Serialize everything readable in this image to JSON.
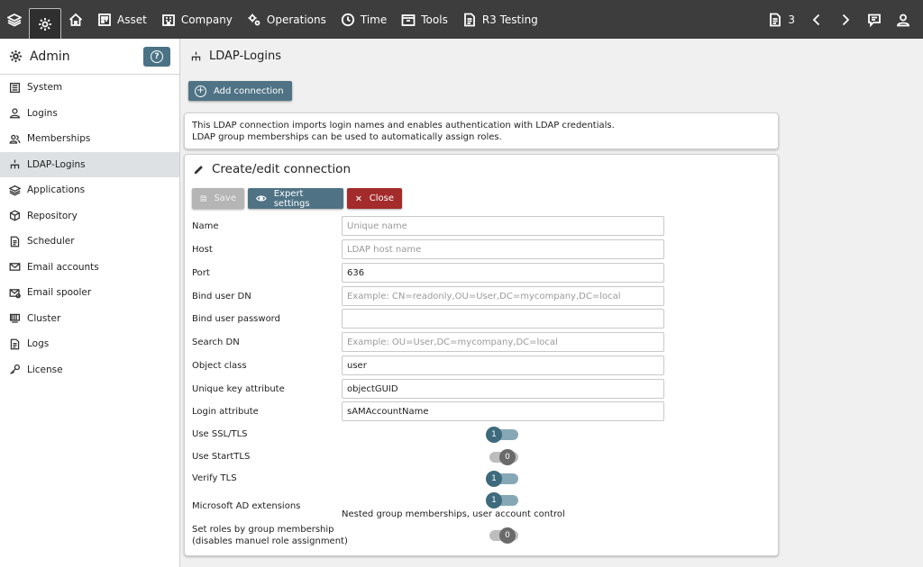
{
  "topbar": {
    "items": [
      {
        "icon": "layers-icon",
        "label": ""
      },
      {
        "icon": "gear-icon",
        "label": ""
      },
      {
        "icon": "home-icon",
        "label": ""
      },
      {
        "icon": "asset-icon",
        "label": "Asset"
      },
      {
        "icon": "company-icon",
        "label": "Company"
      },
      {
        "icon": "operations-icon",
        "label": "Operations"
      },
      {
        "icon": "clock-icon",
        "label": "Time"
      },
      {
        "icon": "tools-icon",
        "label": "Tools"
      },
      {
        "icon": "document-icon",
        "label": "R3 Testing"
      }
    ],
    "right": {
      "doc_count": "3"
    }
  },
  "sidebar": {
    "title": "Admin",
    "help_label": "?",
    "items": [
      {
        "icon": "system-icon",
        "label": "System"
      },
      {
        "icon": "user-icon",
        "label": "Logins"
      },
      {
        "icon": "users-icon",
        "label": "Memberships"
      },
      {
        "icon": "hierarchy-icon",
        "label": "LDAP-Logins"
      },
      {
        "icon": "layers-icon",
        "label": "Applications"
      },
      {
        "icon": "cube-icon",
        "label": "Repository"
      },
      {
        "icon": "scheduler-icon",
        "label": "Scheduler"
      },
      {
        "icon": "mail-icon",
        "label": "Email accounts"
      },
      {
        "icon": "mail-spooler-icon",
        "label": "Email spooler"
      },
      {
        "icon": "cluster-icon",
        "label": "Cluster"
      },
      {
        "icon": "logs-icon",
        "label": "Logs"
      },
      {
        "icon": "key-icon",
        "label": "License"
      }
    ],
    "active_index": 3
  },
  "main": {
    "title": "LDAP-Logins",
    "add_button": "Add connection",
    "info_line1": "This LDAP connection imports login names and enables authentication with LDAP credentials.",
    "info_line2": "LDAP group memberships can be used to automatically assign roles.",
    "form": {
      "title": "Create/edit connection",
      "save_label": "Save",
      "expert_label": "Expert settings",
      "close_label": "Close",
      "fields": [
        {
          "label": "Name",
          "value": "",
          "placeholder": "Unique name"
        },
        {
          "label": "Host",
          "value": "",
          "placeholder": "LDAP host name"
        },
        {
          "label": "Port",
          "value": "636",
          "placeholder": ""
        },
        {
          "label": "Bind user DN",
          "value": "",
          "placeholder": "Example: CN=readonly,OU=User,DC=mycompany,DC=local"
        },
        {
          "label": "Bind user password",
          "value": "",
          "placeholder": ""
        },
        {
          "label": "Search DN",
          "value": "",
          "placeholder": "Example: OU=User,DC=mycompany,DC=local"
        },
        {
          "label": "Object class",
          "value": "user",
          "placeholder": ""
        },
        {
          "label": "Unique key attribute",
          "value": "objectGUID",
          "placeholder": ""
        },
        {
          "label": "Login attribute",
          "value": "sAMAccountName",
          "placeholder": ""
        }
      ],
      "toggles": [
        {
          "label": "Use SSL/TLS",
          "value": "1"
        },
        {
          "label": "Use StartTLS",
          "value": "0"
        },
        {
          "label": "Verify TLS",
          "value": "1"
        },
        {
          "label": "Microsoft AD extensions",
          "value": "1"
        },
        {
          "label_line1": "Set roles by group membership",
          "label_line2": "(disables manuel role assignment)",
          "value": "0"
        }
      ],
      "ad_hint": "Nested group memberships, user account control"
    }
  },
  "colors": {
    "topbar": "#3d3d3d",
    "accent": "#4f7385",
    "danger": "#a32b2b",
    "toggle_on": "#3d6a7d",
    "toggle_off": "#6a6a6a"
  }
}
